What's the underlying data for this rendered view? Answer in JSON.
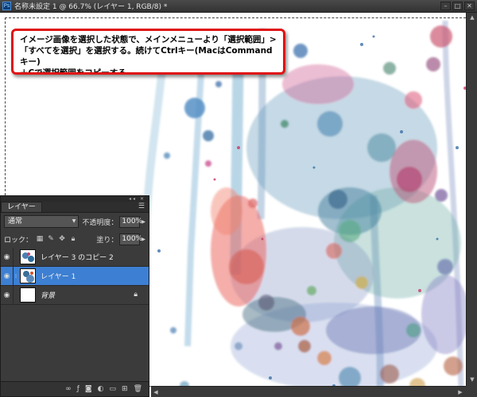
{
  "window": {
    "title": "名称未設定 1 @ 66.7% (レイヤー 1, RGB/8) *",
    "app_icon": "Ps"
  },
  "instruction": {
    "lines": [
      "イメージ画像を選択した状態で、メインメニューより「選択範囲」>",
      "「すべてを選択」を選択する。続けてCtrlキー(MacはCommandキー)",
      "＋Cで選択範囲をコピーする。"
    ],
    "border_color": "#e01414"
  },
  "layers_panel": {
    "tab_label": "レイヤー",
    "blend_mode": "通常",
    "opacity_label": "不透明度：",
    "opacity_value": "100%",
    "lock_label": "ロック：",
    "fill_label": "塗り：",
    "fill_value": "100%",
    "layers": [
      {
        "name": "レイヤー 3 のコピー 2",
        "selected": false
      },
      {
        "name": "レイヤー 1",
        "selected": true
      },
      {
        "name": "背景",
        "selected": false,
        "locked": true
      }
    ],
    "selected_color": "#3d7fd2"
  }
}
